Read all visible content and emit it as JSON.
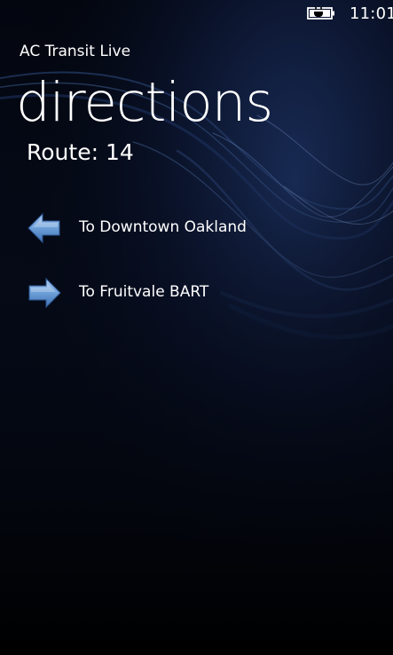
{
  "status_bar": {
    "time": "11:01",
    "battery_icon": "battery-charging-icon"
  },
  "app": {
    "title": "AC Transit Live"
  },
  "page": {
    "title": "directions",
    "route_label": "Route: 14"
  },
  "directions": [
    {
      "label": "To Downtown Oakland",
      "icon": "arrow-left-icon"
    },
    {
      "label": "To Fruitvale BART",
      "icon": "arrow-right-icon"
    }
  ],
  "colors": {
    "background": "#000000",
    "wave": "#1e3a78",
    "arrow": "#6d9fd8",
    "text": "#ffffff"
  }
}
